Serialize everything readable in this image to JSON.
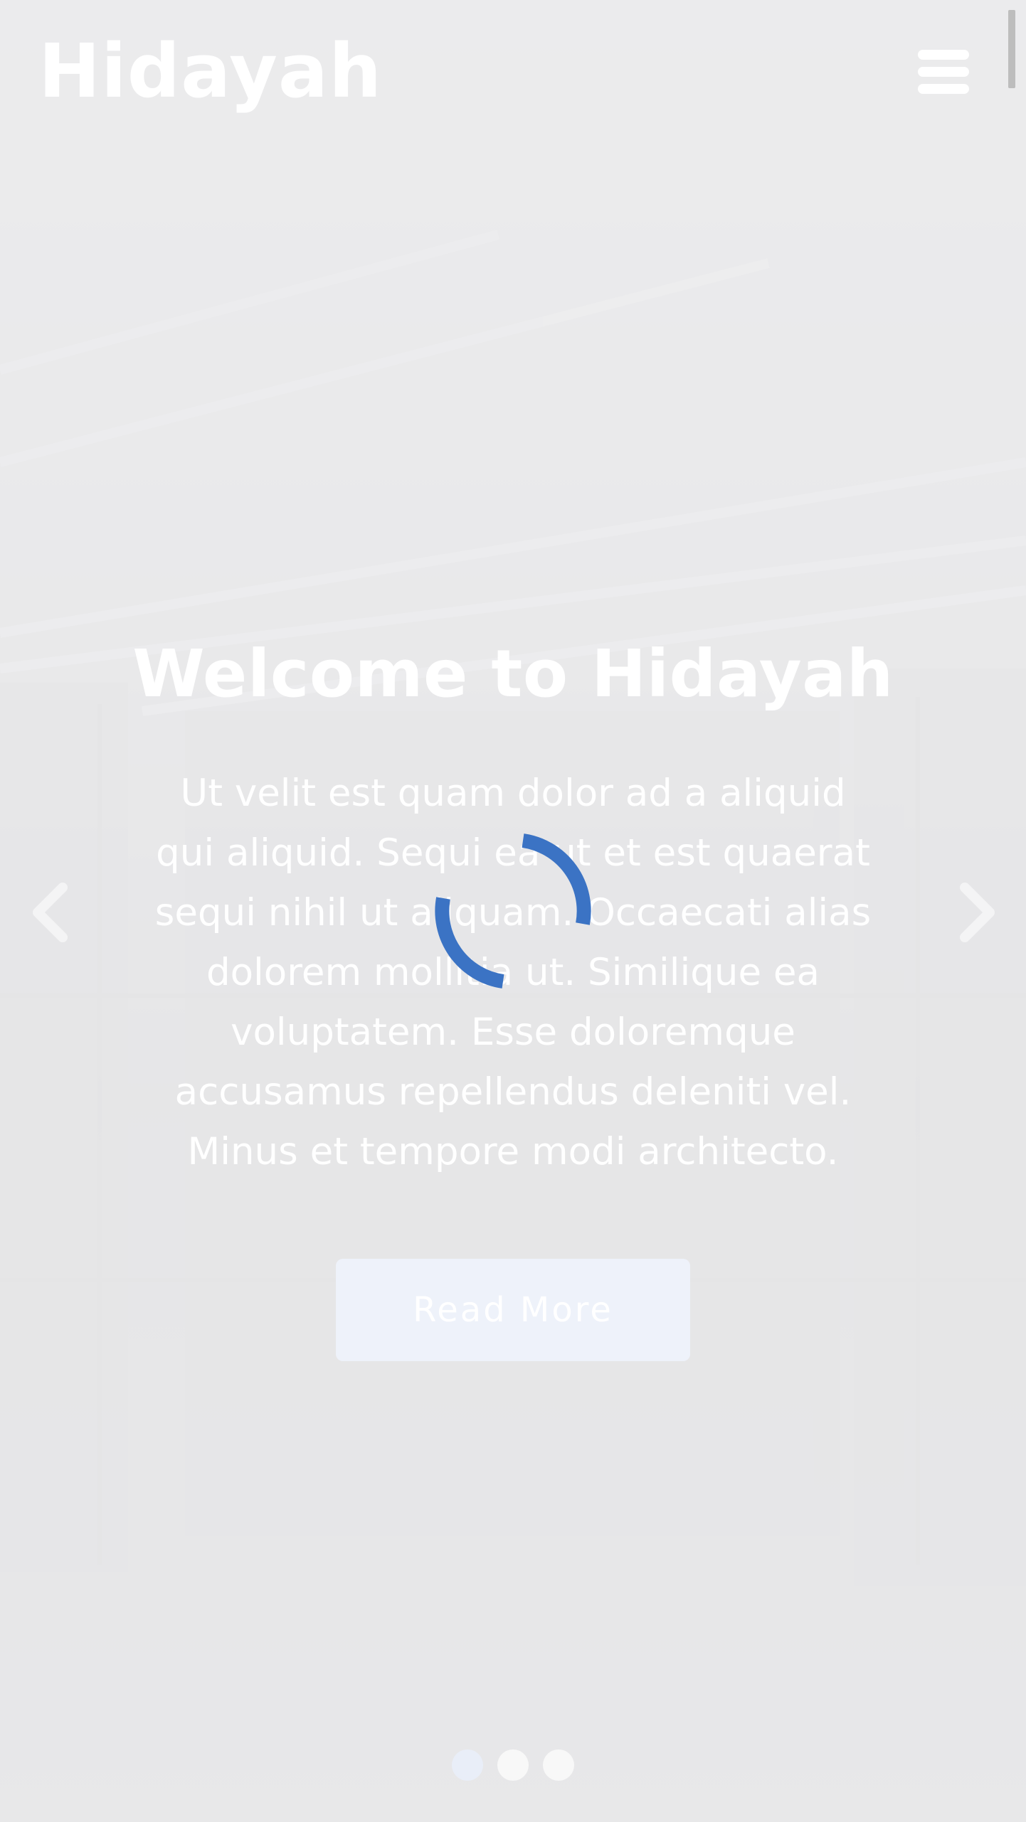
{
  "header": {
    "brand": "Hidayah",
    "menu_icon": "hamburger-menu-icon"
  },
  "slide": {
    "title": "Welcome to Hidayah",
    "text": "Ut velit est quam dolor ad a aliquid qui aliquid. Sequi ea ut et est quaerat sequi nihil ut aliquam. Occaecati alias dolorem mollitia ut. Similique ea voluptatem. Esse doloremque accusamus repellendus deleniti vel. Minus et tempore modi architecto.",
    "button_label": "Read More"
  },
  "carousel": {
    "prev_icon": "chevron-left-icon",
    "next_icon": "chevron-right-icon",
    "slide_count": 3,
    "active_index": 0
  },
  "loader": {
    "icon": "loading-spinner-icon",
    "color": "#3b73c4"
  },
  "colors": {
    "overlay": "#f0f0f1",
    "text": "#ffffff",
    "button_bg": "#eef2fa",
    "dot": "#f8f8f8",
    "dot_active": "#e9eef8"
  }
}
